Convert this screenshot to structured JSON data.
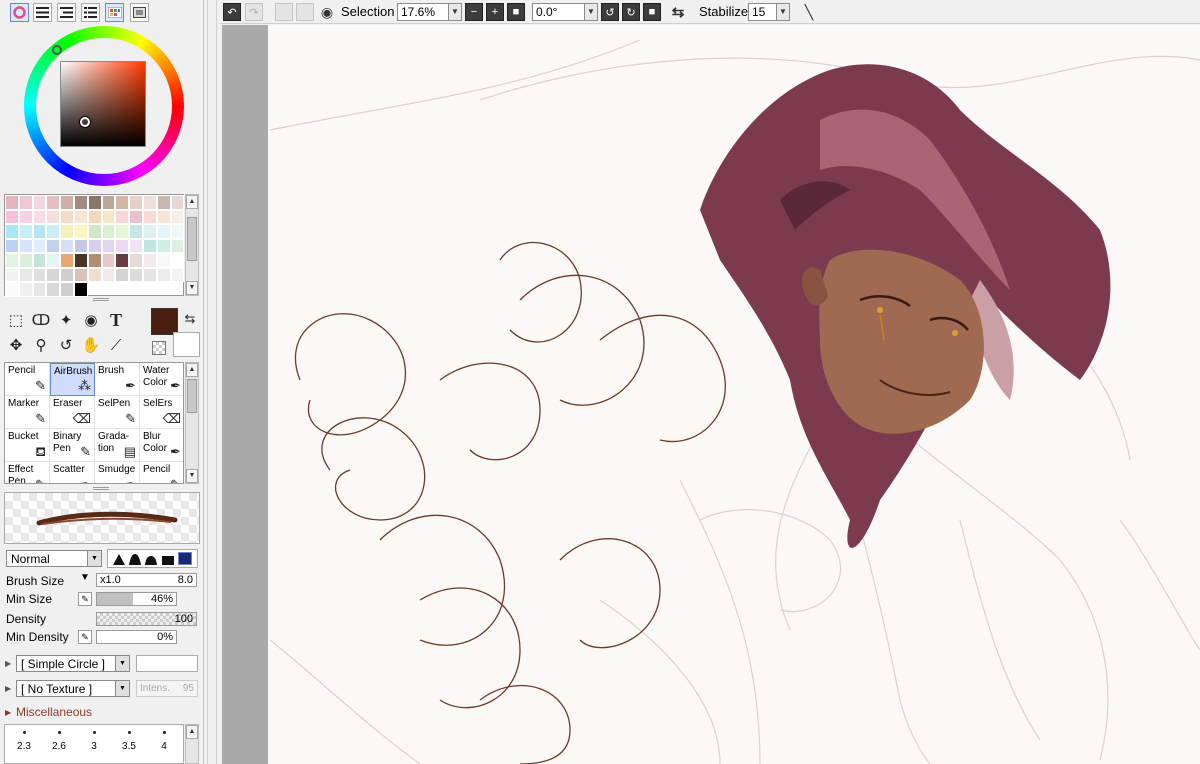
{
  "panel_modes": [
    "color-wheel-icon",
    "rgb-sliders-icon",
    "hsv-sliders-icon",
    "intermediate-color-icon",
    "swatches-icon",
    "scratchpad-icon"
  ],
  "color_wheel": {
    "hue_deg": 10,
    "sv_primary": "#4a1e10"
  },
  "swatches": [
    "#e7b3c0",
    "#efc9d2",
    "#f3d6dc",
    "#e1bfc2",
    "#d2aea8",
    "#a18b80",
    "#8a7664",
    "#bba79a",
    "#d3b7a6",
    "#e6d2c7",
    "#f0dedd",
    "#c9b6ae",
    "#e8d7d1",
    "#f6c0d9",
    "#f7d2e4",
    "#fbdbe6",
    "#f5e0df",
    "#f5dcc9",
    "#f6e6d6",
    "#f4d7b8",
    "#f8e6c9",
    "#f8d5d9",
    "#e8c2ca",
    "#f8dbd6",
    "#fae3d8",
    "#f6efe6",
    "#a8e7f6",
    "#c7eef9",
    "#b8e4f7",
    "#ccedf5",
    "#f6f1ba",
    "#fbf4c3",
    "#cfe7c4",
    "#dbf0ce",
    "#e7f5d8",
    "#c5e8e6",
    "#dff1ef",
    "#e4f4f7",
    "#f1f7f8",
    "#b7d2f3",
    "#d6e4fa",
    "#e1ecfb",
    "#c2d1ec",
    "#d7e0f2",
    "#c2c8e6",
    "#d8d0ee",
    "#e1d6f0",
    "#edd9f5",
    "#f0e3f6",
    "#c2e6df",
    "#d2efe4",
    "#dcefe1",
    "#e2f2e5",
    "#ddeedd",
    "#c3e5d8",
    "#e6f5ef",
    "#e6a771",
    "#4b3325",
    "#b18d73",
    "#e7c9c8",
    "#6a3d45",
    "#e5dbd6",
    "#f2eaea",
    "#f8f8f8",
    "#ffffff",
    "#f2f2f2",
    "#e8e8e8",
    "#e0e0e0",
    "#d6d6d6",
    "#cfcfcf",
    "#d8c4b4",
    "#ece0d6",
    "#f2eae4",
    "#d4d4d4",
    "#dcdcdc",
    "#e4e4e4",
    "#ebebeb",
    "#f3f3f3",
    "#fafafa",
    "#efefef",
    "#e6e6e6",
    "#d9d9d9",
    "#cfcfcf",
    "#000000"
  ],
  "current_colors": {
    "primary": "#4a1e10",
    "secondary": "#ffffff"
  },
  "tools": [
    {
      "name": "rect-select-icon",
      "glyph": "⬚"
    },
    {
      "name": "lasso-icon",
      "glyph": "ↀ"
    },
    {
      "name": "magic-wand-icon",
      "glyph": "✦"
    },
    {
      "name": "select-pen-icon",
      "glyph": "◉"
    },
    {
      "name": "text-tool-icon",
      "glyph": "T"
    },
    {
      "name": "move-icon",
      "glyph": "✥"
    },
    {
      "name": "zoom-icon",
      "glyph": "⚲"
    },
    {
      "name": "rotate-view-icon",
      "glyph": "↺"
    },
    {
      "name": "hand-icon",
      "glyph": "✋"
    },
    {
      "name": "eyedropper-icon",
      "glyph": "⟋"
    }
  ],
  "brushes": [
    {
      "l1": "Pencil",
      "l2": "",
      "icon": "✎"
    },
    {
      "l1": "AirBrush",
      "l2": "",
      "icon": "⁂"
    },
    {
      "l1": "Brush",
      "l2": "",
      "icon": "✒"
    },
    {
      "l1": "Water",
      "l2": "Color",
      "icon": "✒"
    },
    {
      "l1": "Marker",
      "l2": "",
      "icon": "✎"
    },
    {
      "l1": "Eraser",
      "l2": "",
      "icon": "⌫"
    },
    {
      "l1": "SelPen",
      "l2": "",
      "icon": "✎"
    },
    {
      "l1": "SelErs",
      "l2": "",
      "icon": "⌫"
    },
    {
      "l1": "Bucket",
      "l2": "",
      "icon": "⛾"
    },
    {
      "l1": "Binary",
      "l2": "Pen",
      "icon": "✎"
    },
    {
      "l1": "Grada-",
      "l2": "tion",
      "icon": "▤"
    },
    {
      "l1": "Blur",
      "l2": "Color",
      "icon": "✒"
    },
    {
      "l1": "Effect",
      "l2": "Pen",
      "icon": "✎"
    },
    {
      "l1": "Scatter",
      "l2": "",
      "icon": "✒"
    },
    {
      "l1": "Smudge",
      "l2": "",
      "icon": "✒"
    },
    {
      "l1": "Pencil",
      "l2": "",
      "icon": "✎"
    }
  ],
  "blend_mode": "Normal",
  "brush_settings": {
    "size_label": "Brush Size",
    "size_mult": "x1.0",
    "size_value": "8.0",
    "min_size_label": "Min Size",
    "min_size_value": "46%",
    "min_size_fraction": 0.46,
    "density_label": "Density",
    "density_value": "100",
    "min_density_label": "Min Density",
    "min_density_value": "0%"
  },
  "shape_combo": "[ Simple Circle ]",
  "texture_combo": "[ No Texture ]",
  "texture_intensity_label": "Intens.",
  "texture_intensity_value": "95",
  "misc_label": "Miscellaneous",
  "brush_size_presets": [
    "2.3",
    "2.6",
    "3",
    "3.5",
    "4"
  ],
  "toolbar": {
    "selection_label": "Selection",
    "zoom_value": "17.6%",
    "rotation_value": "0.0°",
    "stabilizer_label": "Stabilizer",
    "stabilizer_value": "15"
  }
}
